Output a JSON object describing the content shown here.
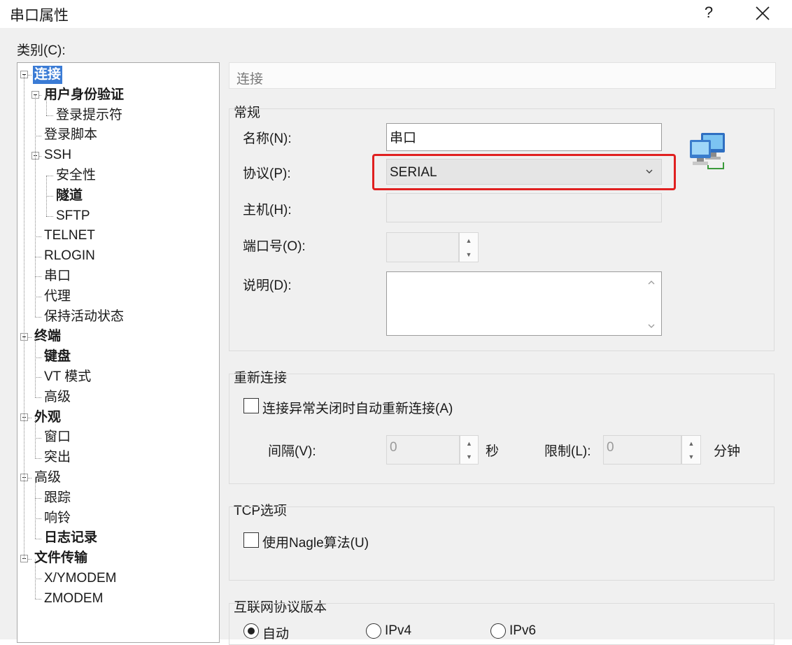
{
  "window": {
    "title": "串口属性",
    "help_label": "?"
  },
  "category_label": "类别(C):",
  "tree": [
    {
      "label": "连接",
      "level": 0,
      "bold": true,
      "selected": true,
      "expanded": true
    },
    {
      "label": "用户身份验证",
      "level": 1,
      "bold": true,
      "expanded": true
    },
    {
      "label": "登录提示符",
      "level": 2,
      "bold": false
    },
    {
      "label": "登录脚本",
      "level": 1,
      "bold": false
    },
    {
      "label": "SSH",
      "level": 1,
      "bold": false,
      "expanded": true
    },
    {
      "label": "安全性",
      "level": 2,
      "bold": false
    },
    {
      "label": "隧道",
      "level": 2,
      "bold": true
    },
    {
      "label": "SFTP",
      "level": 2,
      "bold": false
    },
    {
      "label": "TELNET",
      "level": 1,
      "bold": false
    },
    {
      "label": "RLOGIN",
      "level": 1,
      "bold": false
    },
    {
      "label": "串口",
      "level": 1,
      "bold": false
    },
    {
      "label": "代理",
      "level": 1,
      "bold": false
    },
    {
      "label": "保持活动状态",
      "level": 1,
      "bold": false
    },
    {
      "label": "终端",
      "level": 0,
      "bold": true,
      "expanded": true
    },
    {
      "label": "键盘",
      "level": 1,
      "bold": true
    },
    {
      "label": "VT 模式",
      "level": 1,
      "bold": false
    },
    {
      "label": "高级",
      "level": 1,
      "bold": false
    },
    {
      "label": "外观",
      "level": 0,
      "bold": true,
      "expanded": true
    },
    {
      "label": "窗口",
      "level": 1,
      "bold": false
    },
    {
      "label": "突出",
      "level": 1,
      "bold": false
    },
    {
      "label": "高级",
      "level": 0,
      "bold": false,
      "expanded": true
    },
    {
      "label": "跟踪",
      "level": 1,
      "bold": false
    },
    {
      "label": "响铃",
      "level": 1,
      "bold": false
    },
    {
      "label": "日志记录",
      "level": 1,
      "bold": true
    },
    {
      "label": "文件传输",
      "level": 0,
      "bold": true,
      "expanded": true
    },
    {
      "label": "X/YMODEM",
      "level": 1,
      "bold": false
    },
    {
      "label": "ZMODEM",
      "level": 1,
      "bold": false
    }
  ],
  "panel": {
    "header": "连接",
    "general": {
      "title": "常规",
      "name_label": "名称(N):",
      "name_value": "串口",
      "protocol_label": "协议(P):",
      "protocol_value": "SERIAL",
      "host_label": "主机(H):",
      "port_label": "端口号(O):",
      "desc_label": "说明(D):"
    },
    "reconnect": {
      "title": "重新连接",
      "auto_reconnect_label": "连接异常关闭时自动重新连接(A)",
      "interval_label": "间隔(V):",
      "interval_value": "0",
      "interval_unit": "秒",
      "limit_label": "限制(L):",
      "limit_value": "0",
      "limit_unit": "分钟"
    },
    "tcp": {
      "title": "TCP选项",
      "nagle_label": "使用Nagle算法(U)"
    },
    "ip_version": {
      "title": "互联网协议版本",
      "options": [
        {
          "label": "自动",
          "selected": true
        },
        {
          "label": "IPv4",
          "selected": false
        },
        {
          "label": "IPv6",
          "selected": false
        }
      ]
    }
  },
  "colors": {
    "selection": "#3a7bd5",
    "highlight_border": "#e02020"
  },
  "icons": {
    "network": "network-computers-icon"
  }
}
